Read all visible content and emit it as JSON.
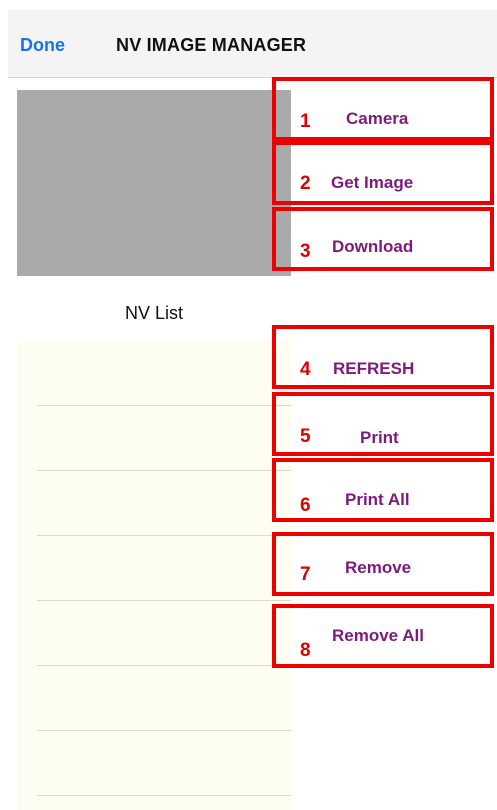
{
  "navbar": {
    "done_label": "Done",
    "title": "NV IMAGE MANAGER"
  },
  "list": {
    "title": "NV List"
  },
  "actions": [
    {
      "number": "1",
      "label": "Camera"
    },
    {
      "number": "2",
      "label": "Get Image"
    },
    {
      "number": "3",
      "label": "Download"
    },
    {
      "number": "4",
      "label": "REFRESH"
    },
    {
      "number": "5",
      "label": "Print"
    },
    {
      "number": "6",
      "label": "Print All"
    },
    {
      "number": "7",
      "label": "Remove"
    },
    {
      "number": "8",
      "label": "Remove All"
    }
  ],
  "colors": {
    "accent_blue": "#1a73e8",
    "highlight_red": "#ec0000",
    "label_purple": "#7d1b7d",
    "list_background": "#fdfdf1",
    "preview_gray": "#aaaaaa"
  }
}
